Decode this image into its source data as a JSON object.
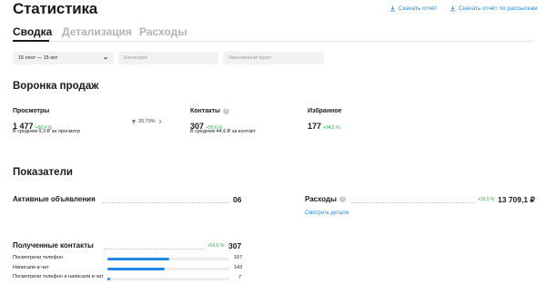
{
  "header": {
    "title": "Статистика",
    "download_report": "Скачать отчёт",
    "download_mailing_report": "Скачать отчёт по рассылкам"
  },
  "tabs": [
    {
      "label": "Сводка",
      "active": true
    },
    {
      "label": "Детализация",
      "active": false
    },
    {
      "label": "Расходы",
      "active": false
    }
  ],
  "filters": {
    "date_range": "15 сент — 15 окт",
    "category_placeholder": "Категория",
    "city_placeholder": "Населённый пункт"
  },
  "funnel": {
    "title": "Воронка продаж",
    "views": {
      "label": "Просмотры",
      "value": "1 477",
      "delta": "+68,4 %",
      "sub": "В среднем 9,3 ₽ за просмотр"
    },
    "conversion": "20,79%",
    "contacts": {
      "label": "Контакты",
      "value": "307",
      "delta": "+56,6 %",
      "sub": "В среднем 44,6 ₽ за контакт"
    },
    "favorites": {
      "label": "Избранное",
      "value": "177",
      "delta": "+94,5 %"
    }
  },
  "indicators": {
    "title": "Показатели",
    "active_ads": {
      "label": "Активные объявления",
      "value": "06"
    },
    "expenses": {
      "label": "Расходы",
      "delta": "+16,5 %",
      "value": "13 709,1 ₽",
      "details_link": "Смотреть детали"
    }
  },
  "received_contacts": {
    "label": "Полученные контакты",
    "delta": "+56,6 %",
    "total": "307",
    "rows": [
      {
        "label": "Посмотрели телефон",
        "value": "157",
        "share": 0.51
      },
      {
        "label": "Написали в чат",
        "value": "143",
        "share": 0.47
      },
      {
        "label": "Посмотрели телефон и написали в чат",
        "value": "7",
        "share": 0.023
      }
    ]
  },
  "colors": {
    "accent": "#1e88e5",
    "positive": "#2ea84b"
  },
  "icons": [
    "download-icon",
    "chevron-down-icon",
    "help-icon",
    "funnel-icon",
    "chevron-right-icon"
  ]
}
